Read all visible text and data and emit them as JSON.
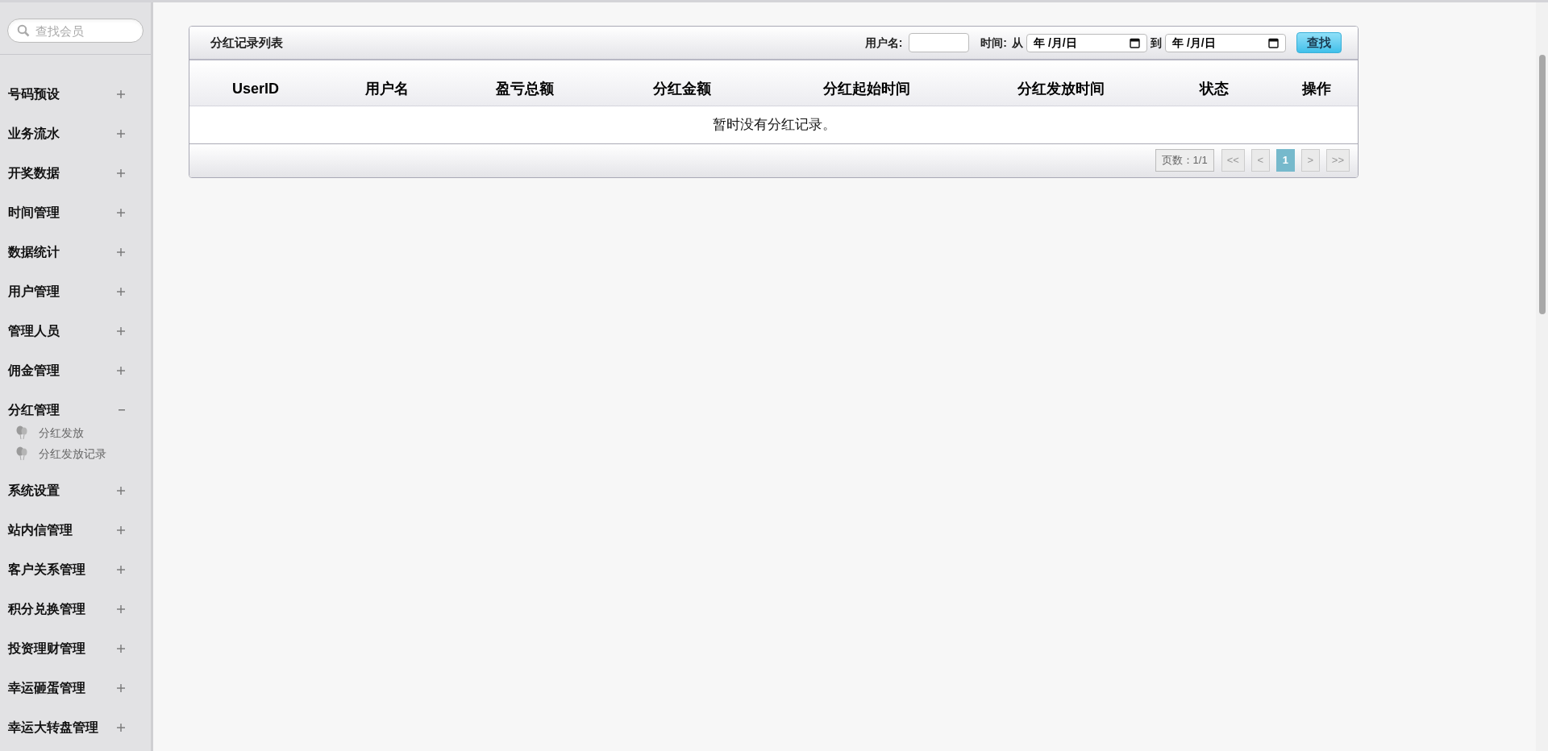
{
  "sidebar": {
    "search": {
      "placeholder": "查找会员"
    },
    "items": [
      {
        "label": "号码预设",
        "expanded": false
      },
      {
        "label": "业务流水",
        "expanded": false
      },
      {
        "label": "开奖数据",
        "expanded": false
      },
      {
        "label": "时间管理",
        "expanded": false
      },
      {
        "label": "数据统计",
        "expanded": false
      },
      {
        "label": "用户管理",
        "expanded": false
      },
      {
        "label": "管理人员",
        "expanded": false
      },
      {
        "label": "佣金管理",
        "expanded": false
      },
      {
        "label": "分红管理",
        "expanded": true,
        "children": [
          {
            "label": "分红发放"
          },
          {
            "label": "分红发放记录"
          }
        ]
      },
      {
        "label": "系统设置",
        "expanded": false
      },
      {
        "label": "站内信管理",
        "expanded": false
      },
      {
        "label": "客户关系管理",
        "expanded": false
      },
      {
        "label": "积分兑换管理",
        "expanded": false
      },
      {
        "label": "投资理财管理",
        "expanded": false
      },
      {
        "label": "幸运砸蛋管理",
        "expanded": false
      },
      {
        "label": "幸运大转盘管理",
        "expanded": false
      }
    ]
  },
  "panel": {
    "title": "分红记录列表",
    "filters": {
      "username_label": "用户名:",
      "time_label": "时间:",
      "from_label": "从",
      "from_date": "年 /月/日",
      "to_label": "到",
      "to_date": "年 /月/日",
      "search_button": "查找"
    },
    "table": {
      "columns": [
        "UserID",
        "用户名",
        "盈亏总额",
        "分红金额",
        "分红起始时间",
        "分红发放时间",
        "状态",
        "操作"
      ],
      "empty_message": "暂时没有分红记录。"
    },
    "pagination": {
      "page_info": "页数：1/1",
      "buttons": [
        {
          "label": "<<",
          "selected": false
        },
        {
          "label": "<",
          "selected": false
        },
        {
          "label": "1",
          "selected": true
        },
        {
          "label": ">",
          "selected": false
        },
        {
          "label": ">>",
          "selected": false
        }
      ]
    }
  }
}
